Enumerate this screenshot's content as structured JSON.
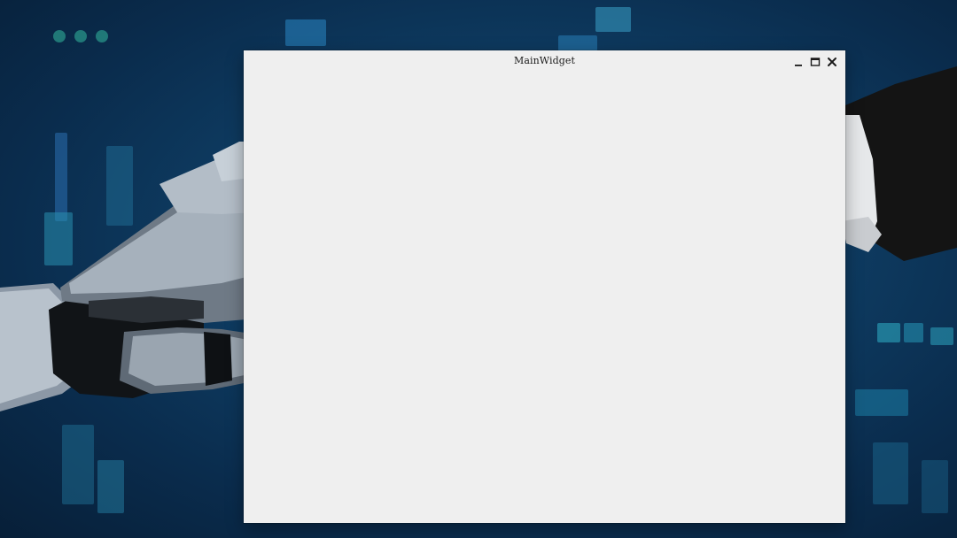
{
  "window": {
    "title": "MainWidget",
    "controls": {
      "minimize_icon": "minimize-icon",
      "maximize_icon": "maximize-icon",
      "close_icon": "close-icon"
    }
  },
  "colors": {
    "window_bg": "#efefef",
    "title_text": "#1a1a1a",
    "desktop_dark": "#0a2c4d",
    "desktop_accent": "#1e8fb5"
  }
}
